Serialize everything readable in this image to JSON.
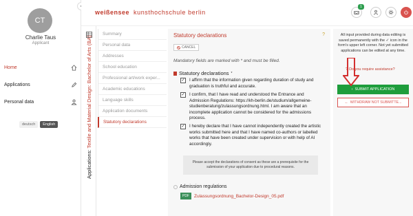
{
  "sidebar": {
    "avatar_initials": "CT",
    "user_name": "Charlie Taus",
    "user_role": "Applicant",
    "nav": [
      {
        "label": "Home",
        "icon": "home-icon"
      },
      {
        "label": "Applications",
        "icon": "pencil-icon"
      },
      {
        "label": "Personal data",
        "icon": "person-icon"
      }
    ],
    "languages": [
      "deutsch",
      "English"
    ]
  },
  "header": {
    "logo_part1": "weißensee",
    "logo_part2": "kunsthochschule berlin",
    "inbox_badge": "1",
    "accent": "#c0392b"
  },
  "application": {
    "vertical_prefix": "Applications:",
    "course": "Textile and Material Design: Bachelor of Arts (BA)"
  },
  "steps": [
    "Summary",
    "Personal data",
    "Addresses",
    "School education",
    "Professional art/work exper...",
    "Academic educations",
    "Language skills",
    "Application documents",
    "Statutory declarations"
  ],
  "main": {
    "title": "Statutory declarations",
    "help": "?",
    "cancel_label": "CANCEL",
    "mandatory_note": "Mandatory fields are marked with * and must be filled.",
    "section_label": "Statutory declarations",
    "required_mark": "*",
    "declarations": [
      "I affirm that the information given regarding duration of study and graduation is truthful and accurate.",
      "I confirm, that I have read and understood the Entrance and Admission Regulations: https://kh-berlin.de/studium/allgemeine-studienberatung/zulassungsordnung.html. I am aware that an incomplete application cannot be considered for the admissions process.",
      "I hereby declare that I have cannot independently created the artistic works submitted here and that I have named co-authors or labelled works that have been created under supervision or with help of AI accordingly."
    ],
    "note": "Please accept the declarations of consent as these are a prerequisite for the submission of your application due to procedural reasons.",
    "admission_label": "Admission regulations",
    "pdf_tag": "PDF",
    "pdf_name": "Zulassungsordnung_Bachelor-Design_05.pdf"
  },
  "right": {
    "info": "All input provided during data editing is saved permanently with the ✓ icon in the form's upper left corner. Not yet submitted applications can be edited at any time.",
    "assist": "Do you require assistance?",
    "submit_label": "SUBMIT APPLICATION",
    "withdraw_label": "WITHDRAW NOT SUBMITTE..."
  }
}
